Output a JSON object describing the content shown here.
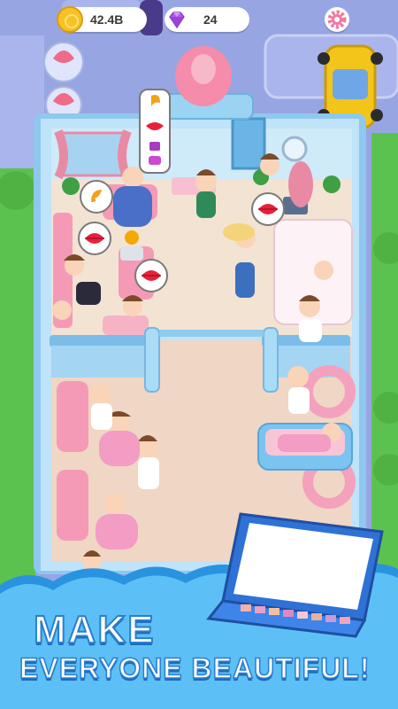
{
  "hud": {
    "coins": "42.4B",
    "gems": "24",
    "coin_icon": "coin-icon",
    "gem_icon": "diamond-icon",
    "settings_icon": "gear-icon"
  },
  "banner": {
    "line1": "MAKE",
    "line2": "EVERYONE BEAUTIFUL!"
  },
  "bubbles": [
    {
      "icon": "lips-icon"
    },
    {
      "icon": "hair-icon"
    },
    {
      "icon": "lips-icon"
    },
    {
      "icon": "lips-icon"
    },
    {
      "icon": "lips-icon"
    },
    {
      "icon": "hair-icon"
    },
    {
      "icon": "lips-icon"
    }
  ],
  "colors": {
    "accent": "#2b7ed0",
    "floor": "#f3e3d3",
    "wall": "#9fd0f0",
    "grass": "#5cc24f",
    "pink": "#f59ab6"
  }
}
